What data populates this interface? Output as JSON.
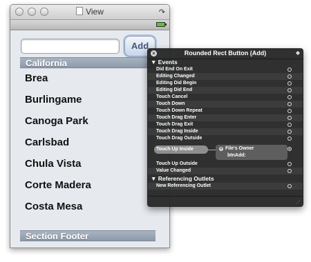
{
  "window": {
    "title": "View"
  },
  "form": {
    "text_field_value": "",
    "add_button_label": "Add"
  },
  "table": {
    "section_header": "California",
    "cities": [
      "Brea",
      "Burlingame",
      "Canoga Park",
      "Carlsbad",
      "Chula Vista",
      "Corte Madera",
      "Costa Mesa"
    ],
    "section_footer": "Section Footer"
  },
  "hud": {
    "title": "Rounded Rect Button (Add)",
    "events_heading": "Events",
    "events": [
      "Did End On Exit",
      "Editing Changed",
      "Editing Did Begin",
      "Editing Did End",
      "Touch Cancel",
      "Touch Down",
      "Touch Down Repeat",
      "Touch Drag Enter",
      "Touch Drag Exit",
      "Touch Drag Inside",
      "Touch Drag Outside"
    ],
    "connected_event": {
      "label": "Touch Up Inside",
      "target": "File's Owner",
      "action": "btnAdd:"
    },
    "events_after": [
      "Touch Up Outside",
      "Value Changed"
    ],
    "outlets_heading": "Referencing Outlets",
    "outlets": [
      "New Referencing Outlet"
    ]
  },
  "colors": {
    "section_bar": "#95a1b1",
    "hud_background": "#282828",
    "button_border": "#8a98b3"
  },
  "icons": {
    "close": "close-icon",
    "battery": "battery-icon",
    "rotate": "rotate-icon",
    "disclosure": "disclosure-triangle-icon",
    "connection_ring": "connection-circle-icon"
  }
}
